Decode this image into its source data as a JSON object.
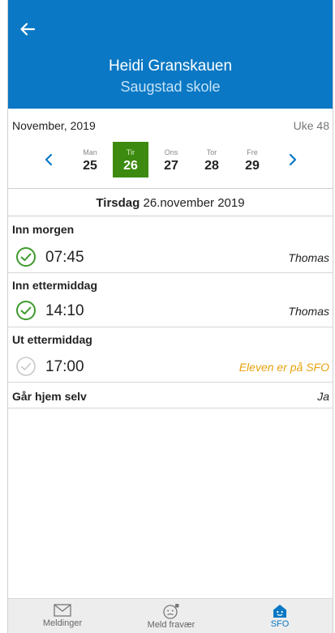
{
  "header": {
    "name": "Heidi Granskauen",
    "school": "Saugstad skole",
    "bg_color": "#0a78c4"
  },
  "calendar": {
    "month": "November, 2019",
    "week": "Uke 48",
    "days": [
      {
        "name": "Man",
        "num": "25",
        "selected": false
      },
      {
        "name": "Tir",
        "num": "26",
        "selected": true
      },
      {
        "name": "Ons",
        "num": "27",
        "selected": false
      },
      {
        "name": "Tor",
        "num": "28",
        "selected": false
      },
      {
        "name": "Fre",
        "num": "29",
        "selected": false
      }
    ],
    "selected_color": "#3d8a10"
  },
  "date_line": {
    "weekday": "Tirsdag",
    "date": "26.november 2019"
  },
  "sections": [
    {
      "title": "Inn morgen",
      "time": "07:45",
      "who": "Thomas",
      "status": "done"
    },
    {
      "title": "Inn ettermiddag",
      "time": "14:10",
      "who": "Thomas",
      "status": "done"
    },
    {
      "title": "Ut ettermiddag",
      "time": "17:00",
      "who": "Eleven er på SFO",
      "status": "pending"
    }
  ],
  "go_home": {
    "label": "Går hjem selv",
    "value": "Ja"
  },
  "tabs": [
    {
      "label": "Meldinger",
      "icon": "envelope-icon"
    },
    {
      "label": "Meld fravær",
      "icon": "sick-face-icon"
    },
    {
      "label": "SFO",
      "icon": "house-icon",
      "active": true
    }
  ],
  "colors": {
    "check_done": "#3d9a2c",
    "check_pending": "#c8c8c8",
    "warning_text": "#e8a20e",
    "active_tab": "#0a78c4"
  }
}
